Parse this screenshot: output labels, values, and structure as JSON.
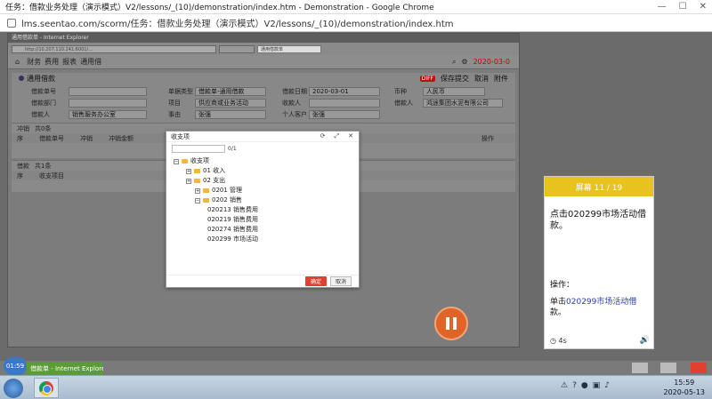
{
  "chrome": {
    "title": "任务：借款业务处理（演示模式）V2/lessons/_(10)/demonstration/index.htm - Demonstration - Google Chrome",
    "url": "lms.seentao.com/scorm/任务：借款业务处理（演示模式）V2/lessons/_(10)/demonstration/index.htm",
    "controls": [
      "—",
      "☐",
      "✕"
    ]
  },
  "ie": {
    "title": "通用借款单 - Internet Explorer",
    "address": "http://10.207.110.241:6001/...",
    "tab_label": "通用借款单",
    "nav": {
      "home": "⌂",
      "crumbs": [
        "财务",
        "费用",
        "报表",
        "通用借"
      ],
      "date": "2020-03-0"
    },
    "form": {
      "title": "通用借款",
      "badge": "DIFF",
      "actions": [
        "保存提交",
        "取消",
        "附件"
      ],
      "labels": {
        "borrower_no": "借款单号",
        "bill_type": "单据类型",
        "apply_date": "借款日期",
        "currency": "币种",
        "dept": "借款部门",
        "project": "项目",
        "payee": "收款人",
        "unit": "借款人",
        "reason": "事由",
        "supplier": "个人客户"
      },
      "values": {
        "bill_type": "借款单-通用借款",
        "project": "供应商或业务活动",
        "apply_date": "2020-03-01",
        "currency": "人民币",
        "payee": "鸿途集团水泥有限公司",
        "dept": "销售服务办公室",
        "unit": "张强",
        "supplier": "张强"
      }
    },
    "sections": [
      {
        "title": "冲销",
        "count": "共0条",
        "cols": [
          "序",
          "借款单号",
          "冲销",
          "冲销金额",
          "",
          "操作"
        ]
      },
      {
        "title": "借款",
        "count": "共1条",
        "cols": [
          "序",
          "收支项目"
        ]
      }
    ]
  },
  "modal": {
    "title": "收支项",
    "search_count": "0/1",
    "controls": [
      "⟳",
      "⤢",
      "✕"
    ],
    "tree": [
      {
        "label": "收支项",
        "level": 0,
        "expander": "−"
      },
      {
        "label": "01 收入",
        "level": 1,
        "expander": "+"
      },
      {
        "label": "02 支出",
        "level": 1,
        "expander": "+"
      },
      {
        "label": "0201 管理",
        "level": 2,
        "expander": "+"
      },
      {
        "label": "0202 销售",
        "level": 2,
        "expander": "−"
      },
      {
        "label": "020213 销售费用",
        "level": 3
      },
      {
        "label": "020219 销售费用",
        "level": 3
      },
      {
        "label": "020274 销售费用",
        "level": 3
      },
      {
        "label": "020299 市场活动",
        "level": 3
      }
    ],
    "ok": "确定",
    "cancel": "取消"
  },
  "panel": {
    "step": "屏幕 11 / 19",
    "main": "点击020299市场活动借款。",
    "op_label": "操作：",
    "hint_prefix": "单击",
    "hint_link": "020299市场活动借",
    "hint_suffix": "款。",
    "timer": "4s",
    "volume": "🔊"
  },
  "strip": {
    "clock": "01:59",
    "task": "借款单 - Internet Explorer"
  },
  "taskbar": {
    "time": "15:59",
    "date": "2020-05-13",
    "tray": [
      "⚠",
      "?",
      "●",
      "▣",
      "♪"
    ]
  }
}
